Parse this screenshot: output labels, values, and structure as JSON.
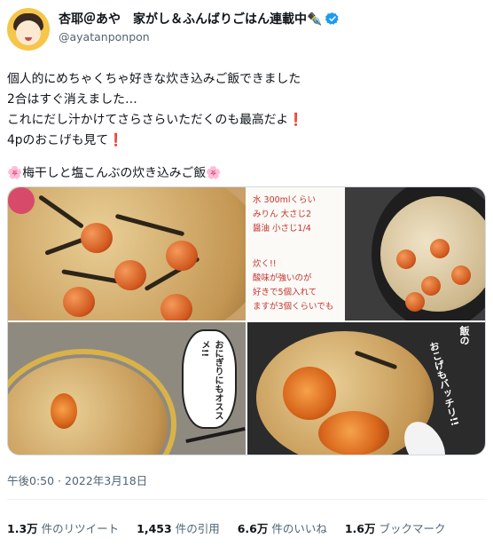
{
  "author": {
    "display_name": "杏耶＠あや　家がし＆ふんばりごはん連載中✒️",
    "handle": "@ayatanponpon",
    "verified": true,
    "avatar_icon": "cartoon-girl-avatar"
  },
  "tweet": {
    "lines": [
      "個人的にめちゃくちゃ好きな炊き込みご飯できました",
      "2合はすぐ消えました…",
      "これにだし汁かけてさらさらいただくのも最高だよ",
      "4pのおこげも見て"
    ],
    "exclamation": "❗",
    "recipe_title": "梅干しと塩こんぶの炊き込みご飯",
    "flower": "🌸"
  },
  "media": {
    "note_lines": [
      "水 300mlくらい",
      "みりん 大さじ2",
      "醤油 小さじ1/4",
      "炊く!!",
      "酸味が強いのが",
      "好きで5個入れて",
      "ますが3個くらいでも"
    ],
    "bubble_text": "おにぎりにもオススメ!!",
    "okoge_text": "おこげもバッチリ!!",
    "okoge_prefix": "飯の"
  },
  "meta": {
    "timestamp": "午後0:50 · 2022年3月18日"
  },
  "stats": [
    {
      "num": "1.3万",
      "label": "件のリツイート"
    },
    {
      "num": "1,453",
      "label": "件の引用"
    },
    {
      "num": "6.6万",
      "label": "件のいいね"
    },
    {
      "num": "1.6万",
      "label": "ブックマーク"
    }
  ],
  "colors": {
    "text": "#0f1419",
    "secondary": "#536471",
    "verified": "#1d9bf0",
    "accent_red": "#e0245e"
  }
}
